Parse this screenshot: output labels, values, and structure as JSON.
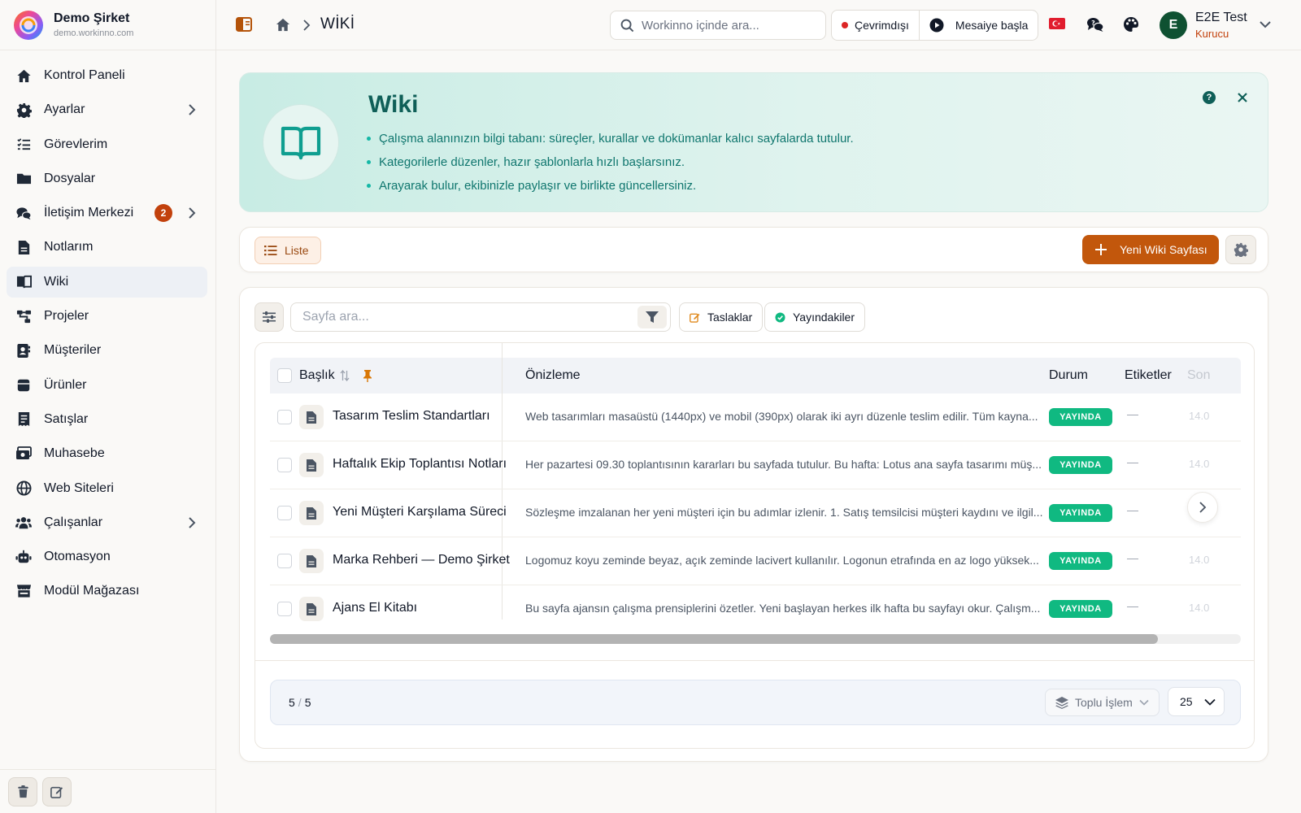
{
  "brand": {
    "name": "Demo Şirket",
    "domain": "demo.workinno.com"
  },
  "sidebar": {
    "items": [
      {
        "label": "Kontrol Paneli",
        "icon": "home-icon"
      },
      {
        "label": "Ayarlar",
        "icon": "gear-icon",
        "chevron": true
      },
      {
        "label": "Görevlerim",
        "icon": "task-list-icon"
      },
      {
        "label": "Dosyalar",
        "icon": "folder-icon"
      },
      {
        "label": "İletişim Merkezi",
        "icon": "chat-icon",
        "badge": "2",
        "chevron": true
      },
      {
        "label": "Notlarım",
        "icon": "note-icon"
      },
      {
        "label": "Wiki",
        "icon": "book-icon",
        "active": true
      },
      {
        "label": "Projeler",
        "icon": "project-icon"
      },
      {
        "label": "Müşteriler",
        "icon": "contact-icon"
      },
      {
        "label": "Ürünler",
        "icon": "box-icon"
      },
      {
        "label": "Satışlar",
        "icon": "receipt-icon"
      },
      {
        "label": "Muhasebe",
        "icon": "money-icon"
      },
      {
        "label": "Web Siteleri",
        "icon": "globe-icon"
      },
      {
        "label": "Çalışanlar",
        "icon": "users-icon",
        "chevron": true
      },
      {
        "label": "Otomasyon",
        "icon": "robot-icon"
      },
      {
        "label": "Modül Mağazası",
        "icon": "store-icon"
      }
    ]
  },
  "topbar": {
    "breadcrumb": "WİKİ",
    "search_placeholder": "Workinno içinde ara...",
    "status_label": "Çevrimdışı",
    "shift_label": "Mesaiye başla",
    "user_initial": "E",
    "user_name": "E2E Test",
    "user_role": "Kurucu"
  },
  "hero": {
    "title": "Wiki",
    "bullets": [
      "Çalışma alanınızın bilgi tabanı: süreçler, kurallar ve dokümanlar kalıcı sayfalarda tutulur.",
      "Kategorilerle düzenler, hazır şablonlarla hızlı başlarsınız.",
      "Arayarak bulur, ekibinizle paylaşır ve birlikte güncellersiniz."
    ],
    "help_glyph": "?"
  },
  "toolbar": {
    "view_label": "Liste",
    "new_label": "Yeni Wiki Sayfası"
  },
  "filters": {
    "search_placeholder": "Sayfa ara...",
    "drafts_label": "Taslaklar",
    "published_label": "Yayındakiler"
  },
  "table": {
    "columns": {
      "title": "Başlık",
      "preview": "Önizleme",
      "status": "Durum",
      "tags": "Etiketler",
      "last": "Son"
    },
    "rows": [
      {
        "title": "Tasarım Teslim Standartları",
        "preview": "Web tasarımları masaüstü (1440px) ve mobil (390px) olarak iki ayrı düzenle teslim edilir. Tüm kayna...",
        "status": "YAYINDA",
        "tags": "—",
        "date": "14.0"
      },
      {
        "title": "Haftalık Ekip Toplantısı Notları",
        "preview": "Her pazartesi 09.30 toplantısının kararları bu sayfada tutulur. Bu hafta: Lotus ana sayfa tasarımı müş...",
        "status": "YAYINDA",
        "tags": "—",
        "date": "14.0"
      },
      {
        "title": "Yeni Müşteri Karşılama Süreci",
        "preview": "Sözleşme imzalanan her yeni müşteri için bu adımlar izlenir. 1. Satış temsilcisi müşteri kaydını ve ilgil...",
        "status": "YAYINDA",
        "tags": "—",
        "date": "14.0"
      },
      {
        "title": "Marka Rehberi — Demo Şirket",
        "preview": "Logomuz koyu zeminde beyaz, açık zeminde lacivert kullanılır. Logonun etrafında en az logo yüksek...",
        "status": "YAYINDA",
        "tags": "—",
        "date": "14.0"
      },
      {
        "title": "Ajans El Kitabı",
        "preview": "Bu sayfa ajansın çalışma prensiplerini özetler. Yeni başlayan herkes ilk hafta bu sayfayı okur. Çalışm...",
        "status": "YAYINDA",
        "tags": "—",
        "date": "14.0"
      }
    ]
  },
  "pager": {
    "shown": "5",
    "total": "5",
    "bulk_label": "Toplu İşlem",
    "page_size": "25"
  },
  "colors": {
    "accent": "#c2570c",
    "teal": "#0f766e",
    "published": "#10b981",
    "badge": "#c2410c"
  }
}
